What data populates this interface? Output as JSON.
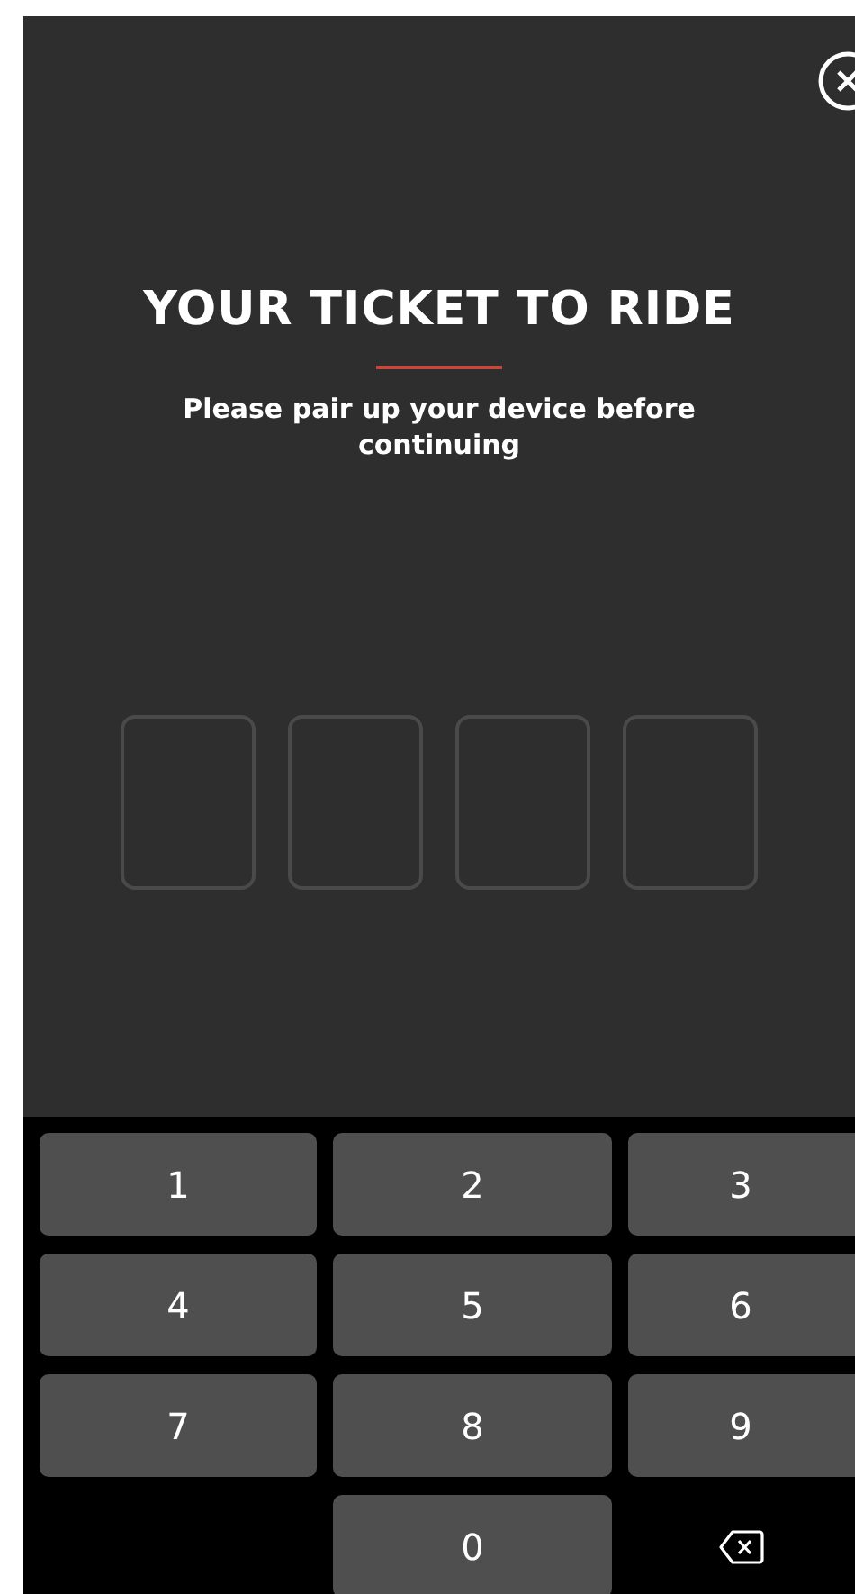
{
  "title": "YOUR TICKET TO RIDE",
  "subtitle": "Please pair up your device before continuing",
  "code_boxes": [
    {
      "filled": false
    },
    {
      "filled": false
    },
    {
      "filled": false
    },
    {
      "filled": false
    }
  ],
  "keypad": [
    {
      "kind": "digit",
      "label": "1"
    },
    {
      "kind": "digit",
      "label": "2"
    },
    {
      "kind": "digit",
      "label": "3"
    },
    {
      "kind": "digit",
      "label": "4"
    },
    {
      "kind": "digit",
      "label": "5"
    },
    {
      "kind": "digit",
      "label": "6"
    },
    {
      "kind": "digit",
      "label": "7"
    },
    {
      "kind": "digit",
      "label": "8"
    },
    {
      "kind": "digit",
      "label": "9"
    },
    {
      "kind": "blank"
    },
    {
      "kind": "digit",
      "label": "0"
    },
    {
      "kind": "backspace"
    }
  ]
}
